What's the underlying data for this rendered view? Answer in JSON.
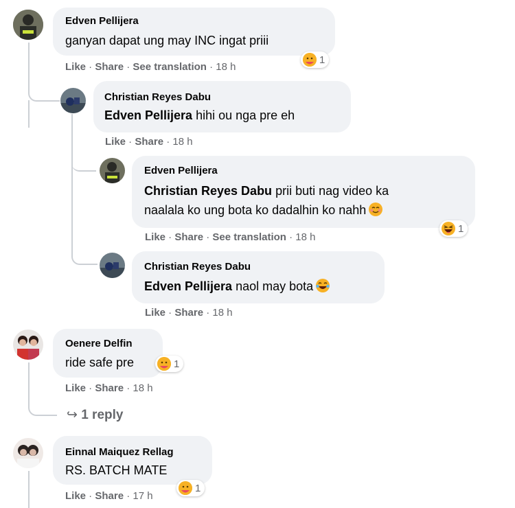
{
  "actions": {
    "like": "Like",
    "share": "Share",
    "see_translation": "See translation",
    "sep": " · "
  },
  "comments": [
    {
      "name": "Edven Pellijera",
      "text": "ganyan dapat ung may INC ingat priii",
      "time": "18 h",
      "reaction_count": "1"
    },
    {
      "name": "Christian Reyes Dabu",
      "mention": "Edven Pellijera",
      "text": " hihi ou nga pre eh",
      "time": "18 h"
    },
    {
      "name": "Edven Pellijera",
      "mention": "Christian Reyes Dabu",
      "text_line1": " prii buti nag video ka",
      "text_line2": "naalala ko ung bota ko dadalhin ko nahh",
      "time": "18 h",
      "reaction_count": "1"
    },
    {
      "name": "Christian Reyes Dabu",
      "mention": "Edven Pellijera",
      "text": " naol may bota",
      "time": "18 h"
    },
    {
      "name": "Oenere Delfin",
      "text": "ride safe pre",
      "time": "18 h",
      "reaction_count": "1"
    },
    {
      "name": "Einnal Maiquez Rellag",
      "text": "RS. BATCH MATE",
      "time": "17 h",
      "reaction_count": "1"
    }
  ],
  "reply_link": "1 reply",
  "colors": {
    "bubble": "#f0f2f5",
    "meta": "#65676b",
    "care": "#f7b125",
    "thread_line": "#ccd0d5"
  }
}
